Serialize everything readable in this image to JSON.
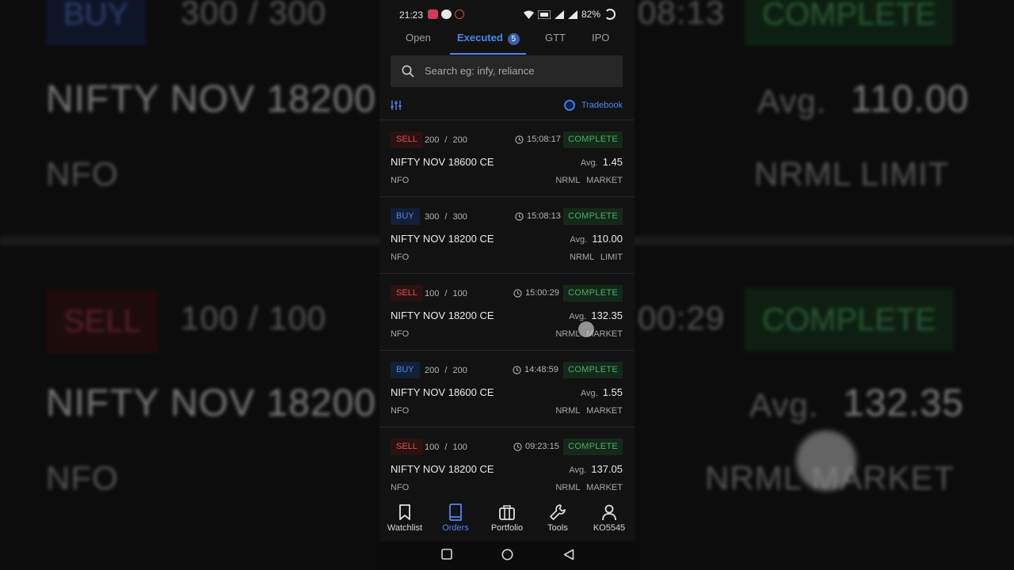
{
  "statusbar": {
    "time": "21:23",
    "battery": "82%"
  },
  "tabs": [
    {
      "label": "Open"
    },
    {
      "label": "Executed",
      "badge": "5"
    },
    {
      "label": "GTT"
    },
    {
      "label": "IPO"
    }
  ],
  "search": {
    "placeholder": "Search eg: infy, reliance"
  },
  "tradebook_label": "Tradebook",
  "orders": [
    {
      "type": "SELL",
      "filled": "200",
      "total": "200",
      "time": "15:08:17",
      "status": "COMPLETE",
      "symbol": "NIFTY NOV 18600 CE",
      "avg_label": "Avg.",
      "avg": "1.45",
      "exchange": "NFO",
      "product": "NRML",
      "order_type": "MARKET"
    },
    {
      "type": "BUY",
      "filled": "300",
      "total": "300",
      "time": "15:08:13",
      "status": "COMPLETE",
      "symbol": "NIFTY NOV 18200 CE",
      "avg_label": "Avg.",
      "avg": "110.00",
      "exchange": "NFO",
      "product": "NRML",
      "order_type": "LIMIT"
    },
    {
      "type": "SELL",
      "filled": "100",
      "total": "100",
      "time": "15:00:29",
      "status": "COMPLETE",
      "symbol": "NIFTY NOV 18200 CE",
      "avg_label": "Avg.",
      "avg": "132.35",
      "exchange": "NFO",
      "product": "NRML",
      "order_type": "MARKET"
    },
    {
      "type": "BUY",
      "filled": "200",
      "total": "200",
      "time": "14:48:59",
      "status": "COMPLETE",
      "symbol": "NIFTY NOV 18600 CE",
      "avg_label": "Avg.",
      "avg": "1.55",
      "exchange": "NFO",
      "product": "NRML",
      "order_type": "MARKET"
    },
    {
      "type": "SELL",
      "filled": "100",
      "total": "100",
      "time": "09:23:15",
      "status": "COMPLETE",
      "symbol": "NIFTY NOV 18200 CE",
      "avg_label": "Avg.",
      "avg": "137.05",
      "exchange": "NFO",
      "product": "NRML",
      "order_type": "MARKET"
    }
  ],
  "bottom_nav": [
    {
      "label": "Watchlist",
      "icon": "bookmark-icon"
    },
    {
      "label": "Orders",
      "icon": "book-icon",
      "active": true
    },
    {
      "label": "Portfolio",
      "icon": "briefcase-icon"
    },
    {
      "label": "Tools",
      "icon": "wrench-icon"
    },
    {
      "label": "KO5545",
      "icon": "user-icon"
    }
  ],
  "background": {
    "buy_tag": "BUY",
    "qty_top": "300  /  300",
    "time_top": "08:13",
    "complete_top": "COMPLETE",
    "symbol_top": "NIFTY NOV 18200",
    "avg_label": "Avg.",
    "avg_top": "110.00",
    "exch_top": "NFO",
    "product_top": "NRML  LIMIT",
    "sell_tag": "SELL",
    "qty_bottom": "100  /  100",
    "time_bottom": "00:29",
    "complete_bottom": "COMPLETE",
    "symbol_bottom": "NIFTY NOV 18200",
    "avg_bottom": "132.35",
    "exch_bottom": "NFO",
    "product_bottom": "NRML  MARKET"
  },
  "colors": {
    "accent": "#4c86f0",
    "sell": "#e0504d",
    "complete": "#4caf63",
    "background": "#121212"
  }
}
